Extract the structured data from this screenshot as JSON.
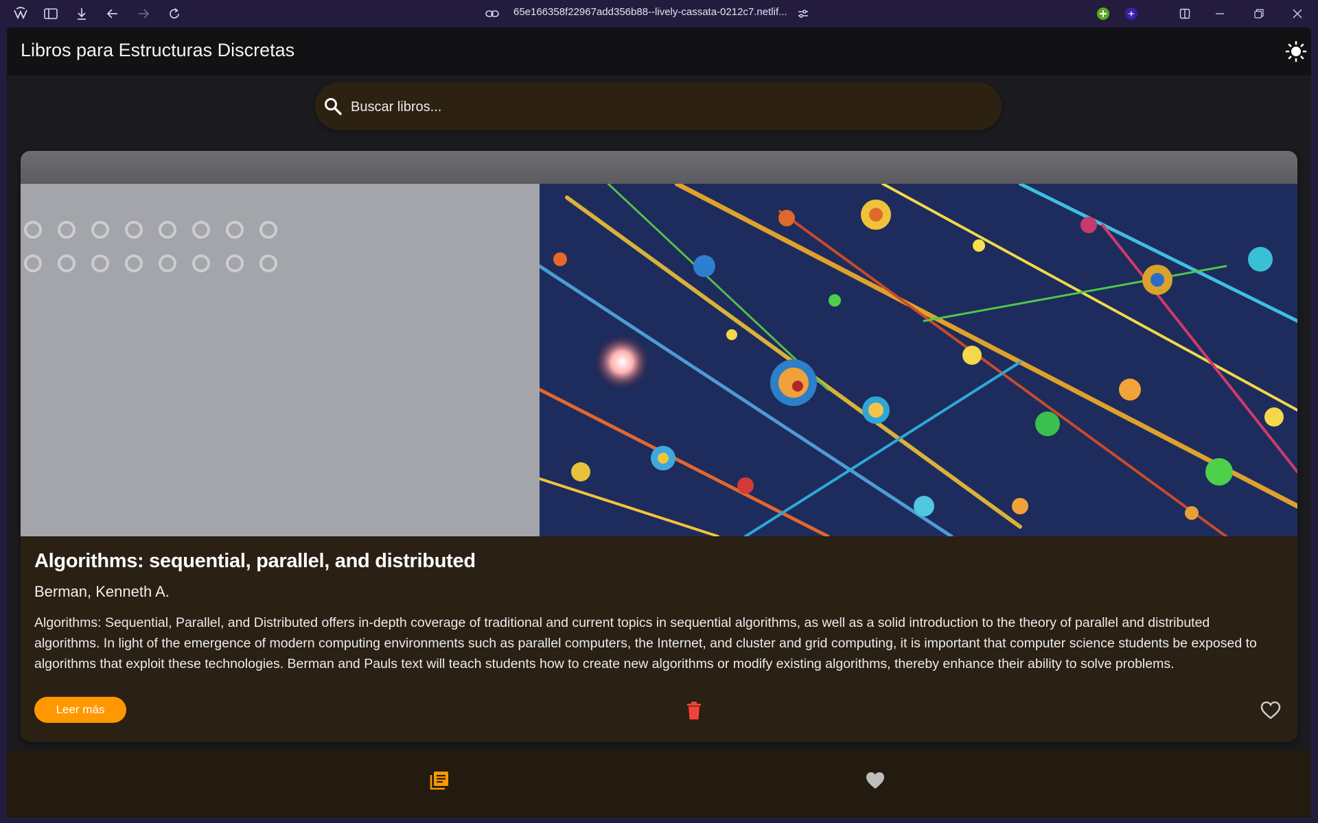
{
  "browser": {
    "url": "65e166358f22967add356b88--lively-cassata-0212c7.netlif...",
    "icons": [
      "app-logo-icon",
      "sidebar-toggle-icon",
      "download-icon",
      "back-icon",
      "forward-icon",
      "reload-icon",
      "link-icon",
      "site-settings-icon",
      "extension-plus-icon",
      "extension-star-icon",
      "split-view-icon",
      "minimize-icon",
      "restore-icon",
      "close-icon"
    ]
  },
  "appbar": {
    "title": "Libros para Estructuras Discretas",
    "theme_icon": "sun-icon"
  },
  "search": {
    "placeholder": "Buscar libros...",
    "icon": "search-icon"
  },
  "books": [
    {
      "title": "Algorithms: sequential, parallel, and distributed",
      "author": "Berman, Kenneth A.",
      "description": "Algorithms: Sequential, Parallel, and Distributed offers in-depth coverage of traditional and current topics in sequential algorithms, as well as a solid introduction to the theory of parallel and distributed algorithms. In light of the emergence of modern computing environments such as parallel computers, the Internet, and cluster and grid computing, it is important that computer science students be exposed to algorithms that exploit these technologies. Berman and Pauls text will teach students how to create new algorithms or modify existing algorithms, thereby enhance their ability to solve problems.",
      "read_more_label": "Leer más",
      "delete_icon": "trash-icon",
      "favorite_icon": "heart-outline-icon"
    }
  ],
  "bottom_nav": {
    "items": [
      {
        "icon": "library-books-icon",
        "active": true
      },
      {
        "icon": "heart-icon",
        "active": false
      }
    ]
  },
  "colors": {
    "accent": "#ff9800",
    "delete": "#f44336",
    "card": "#2a2013",
    "appbar": "#121214"
  }
}
